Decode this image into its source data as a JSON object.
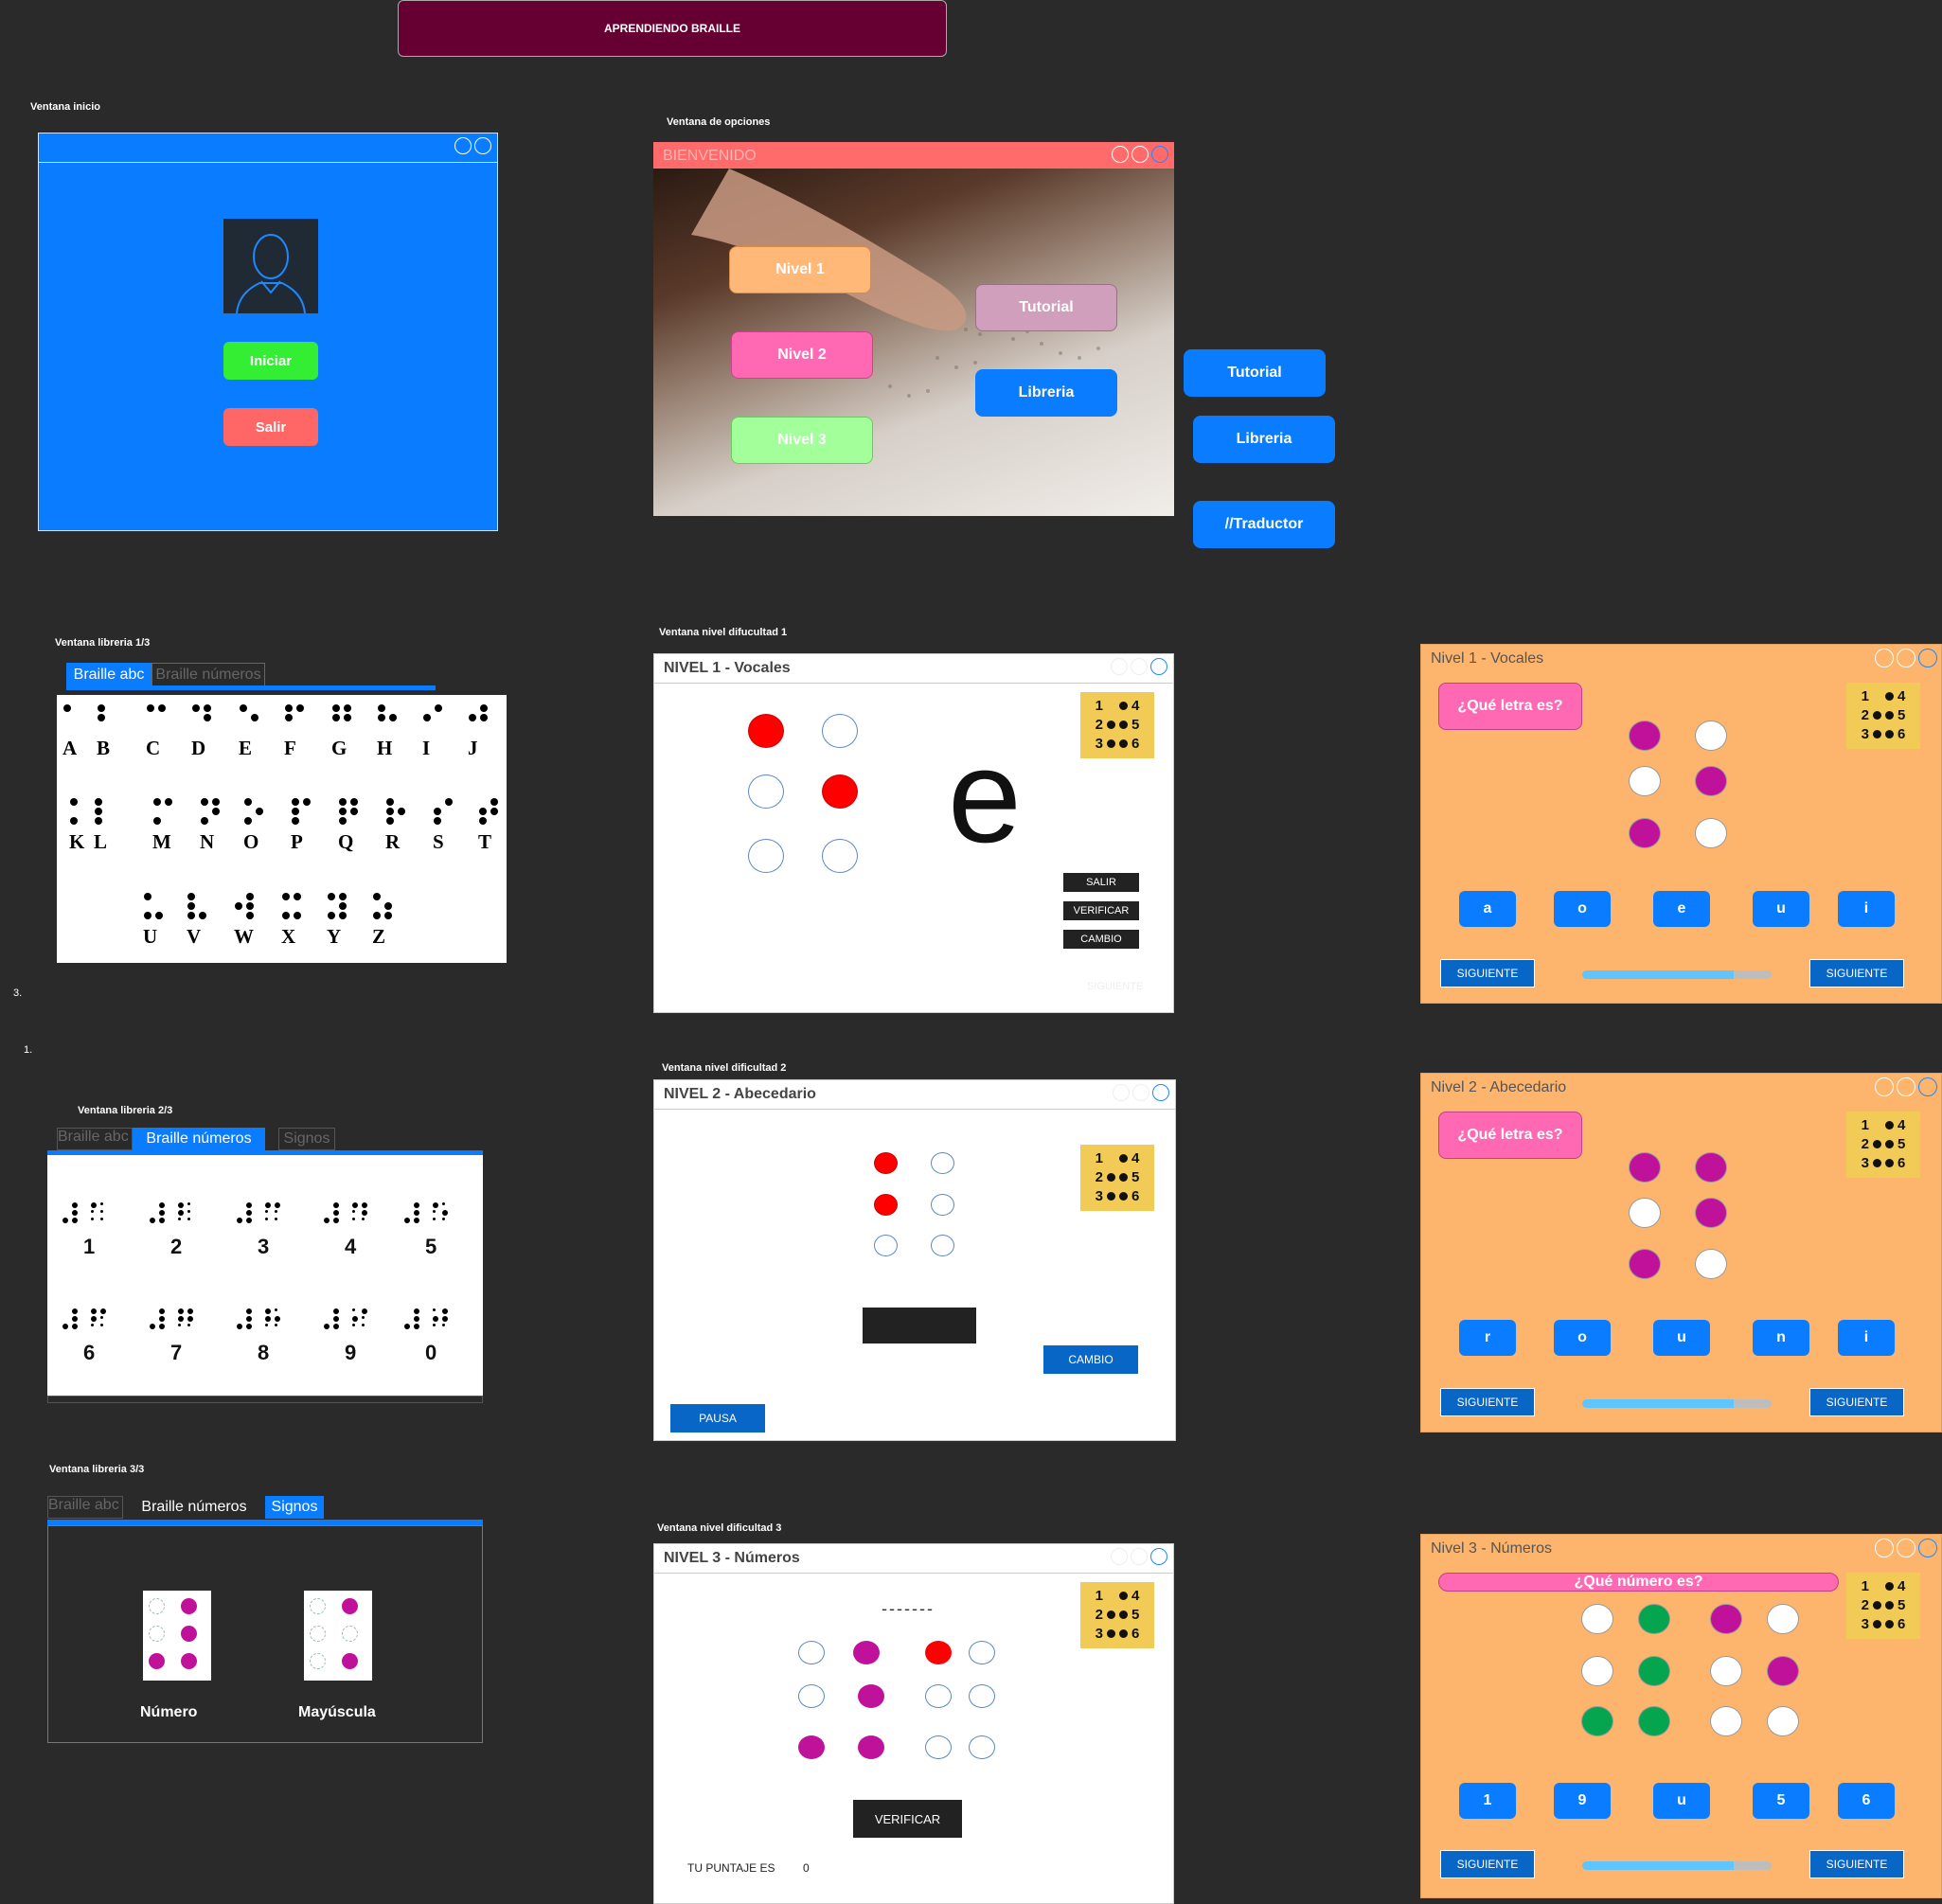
{
  "app_title": "APRENDIENDO BRAILLE",
  "sections": {
    "inicio": "Ventana inicio",
    "opciones": "Ventana de opciones",
    "libreria1": "Ventana libreria 1/3",
    "libreria2": "Ventana libreria 2/3",
    "libreria3": "Ventana libreria 3/3",
    "nivel1": "Ventana nivel difucultad 1",
    "nivel2": "Ventana nivel dificultad 2",
    "nivel3": "Ventana nivel dificultad 3"
  },
  "notes": {
    "n3": "3.",
    "n1": "1."
  },
  "inicio": {
    "start": "Iniciar",
    "exit": "Salir"
  },
  "opciones": {
    "title": "BIENVENIDO",
    "nivel1": "Nivel 1",
    "nivel2": "Nivel 2",
    "nivel3": "Nivel 3",
    "tutorial": "Tutorial",
    "libreria": "Libreria",
    "side_tutorial": "Tutorial",
    "side_libreria": "Libreria",
    "side_traductor": "//Traductor"
  },
  "libreria": {
    "tab_abc": "Braille abc",
    "tab_num": "Braille números",
    "tab_signos": "Signos",
    "letters_row1": [
      "A",
      "B",
      "C",
      "D",
      "E",
      "F",
      "G",
      "H",
      "I",
      "J"
    ],
    "letters_row2": [
      "K",
      "L",
      "M",
      "N",
      "O",
      "P",
      "Q",
      "R",
      "S",
      "T"
    ],
    "letters_row3": [
      "U",
      "V",
      "W",
      "X",
      "Y",
      "Z"
    ],
    "digits_row1": [
      "1",
      "2",
      "3",
      "4",
      "5"
    ],
    "digits_row2": [
      "6",
      "7",
      "8",
      "9",
      "0"
    ],
    "sign_numero": "Número",
    "sign_mayuscula": "Mayúscula"
  },
  "chip": {
    "n1": "1",
    "n2": "2",
    "n3": "3",
    "n4": "4",
    "n5": "5",
    "n6": "6"
  },
  "nivel1": {
    "title": "NIVEL 1 - Vocales",
    "letter": "e",
    "salir": "SALIR",
    "verificar": "VERIFICAR",
    "cambio": "CAMBIO",
    "siguiente": "SIGUIENTE"
  },
  "nivel2": {
    "title": "NIVEL 2 - Abecedario",
    "cambio": "CAMBIO",
    "pausa": "PAUSA"
  },
  "nivel3": {
    "title": "NIVEL 3 - Números",
    "dashes": "-------",
    "verificar": "VERIFICAR",
    "score_label": "TU PUNTAJE ES",
    "score": "0"
  },
  "orange1": {
    "title": "Nivel 1 - Vocales",
    "question": "¿Qué letra es?",
    "options": [
      "a",
      "o",
      "e",
      "u",
      "i"
    ],
    "siguiente": "SIGUIENTE",
    "progress": 0.8
  },
  "orange2": {
    "title": "Nivel 2 - Abecedario",
    "question": "¿Qué letra es?",
    "options": [
      "r",
      "o",
      "u",
      "n",
      "i"
    ],
    "siguiente": "SIGUIENTE",
    "progress": 0.8
  },
  "orange3": {
    "title": "Nivel 3 - Números",
    "question": "¿Qué número es?",
    "options": [
      "1",
      "9",
      "u",
      "5",
      "6"
    ],
    "siguiente": "SIGUIENTE",
    "progress": 0.8
  },
  "colors": {
    "blue": "#0a7cff",
    "orange": "#fdb46c",
    "pink": "#ff69b4",
    "magenta": "#c0119b",
    "red": "#ff0000",
    "green": "#05a550",
    "yellow": "#f2cb56"
  }
}
